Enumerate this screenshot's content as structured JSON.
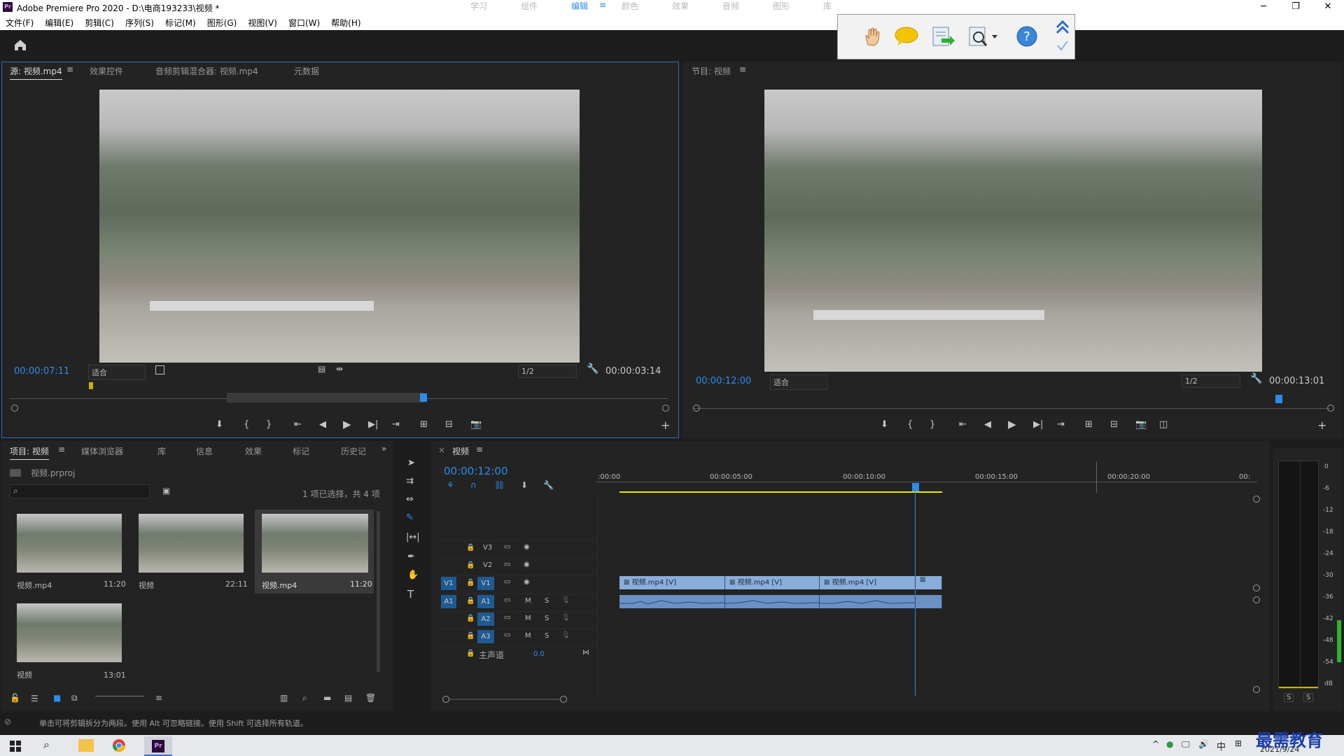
{
  "app": {
    "title": "Adobe Premiere Pro 2020 - D:\\电商193233\\视频 *",
    "logo": "Pr"
  },
  "menu": [
    "文件(F)",
    "编辑(E)",
    "剪辑(C)",
    "序列(S)",
    "标记(M)",
    "图形(G)",
    "视图(V)",
    "窗口(W)",
    "帮助(H)"
  ],
  "workspaces": [
    "学习",
    "组件",
    "编辑",
    "颜色",
    "效果",
    "音频",
    "图形",
    "库"
  ],
  "active_workspace": "编辑",
  "colors": {
    "accent": "#2d8ceb",
    "clip_video": "#8aaedc",
    "clip_audio": "#6a90c4",
    "playhead": "#2d8ceb",
    "workarea": "#e6e600"
  },
  "source": {
    "tabs": [
      "源: 视频.mp4",
      "效果控件",
      "音频剪辑混合器: 视频.mp4",
      "元数据"
    ],
    "timecode": "00:00:07:11",
    "fit": "适合",
    "res": "1/2",
    "duration": "00:00:03:14"
  },
  "program": {
    "tab": "节目: 视频",
    "timecode": "00:00:12:00",
    "fit": "适合",
    "res": "1/2",
    "duration": "00:00:13:01"
  },
  "project": {
    "tabs": [
      "项目: 视频",
      "媒体浏览器",
      "库",
      "信息",
      "效果",
      "标记",
      "历史记"
    ],
    "file": "视频.prproj",
    "count": "1 项已选择，共 4 项",
    "items": [
      {
        "name": "视频.mp4",
        "dur": "11:20"
      },
      {
        "name": "视频",
        "dur": "22:11"
      },
      {
        "name": "视频.mp4",
        "dur": "11:20"
      },
      {
        "name": "视频",
        "dur": "13:01"
      }
    ]
  },
  "timeline": {
    "tab": "视频",
    "timecode": "00:00:12:00",
    "ruler": [
      ":00:00",
      "00:00:05:00",
      "00:00:10:00",
      "00:00:15:00",
      "00:00:20:00",
      "00:"
    ],
    "video_tracks": [
      "V3",
      "V2",
      "V1"
    ],
    "audio_tracks": [
      "A1",
      "A2",
      "A3"
    ],
    "master": "主声道",
    "master_val": "0.0",
    "clip_label": "视频.mp4 [V]",
    "src_v": "V1",
    "src_a": "A1",
    "mute": "M",
    "solo": "S"
  },
  "meter": {
    "scale": [
      "0",
      "-6",
      "-12",
      "-18",
      "-24",
      "-30",
      "-36",
      "-42",
      "-48",
      "-54",
      "dB"
    ],
    "solo": [
      "S",
      "S"
    ]
  },
  "status": "单击可将剪辑拆分为两段。使用 Alt 可忽略链接。使用 Shift 可选择所有轨道。",
  "taskbar": {
    "ime": "中",
    "date": "2021/9/24",
    "watermark": "最需教育"
  }
}
